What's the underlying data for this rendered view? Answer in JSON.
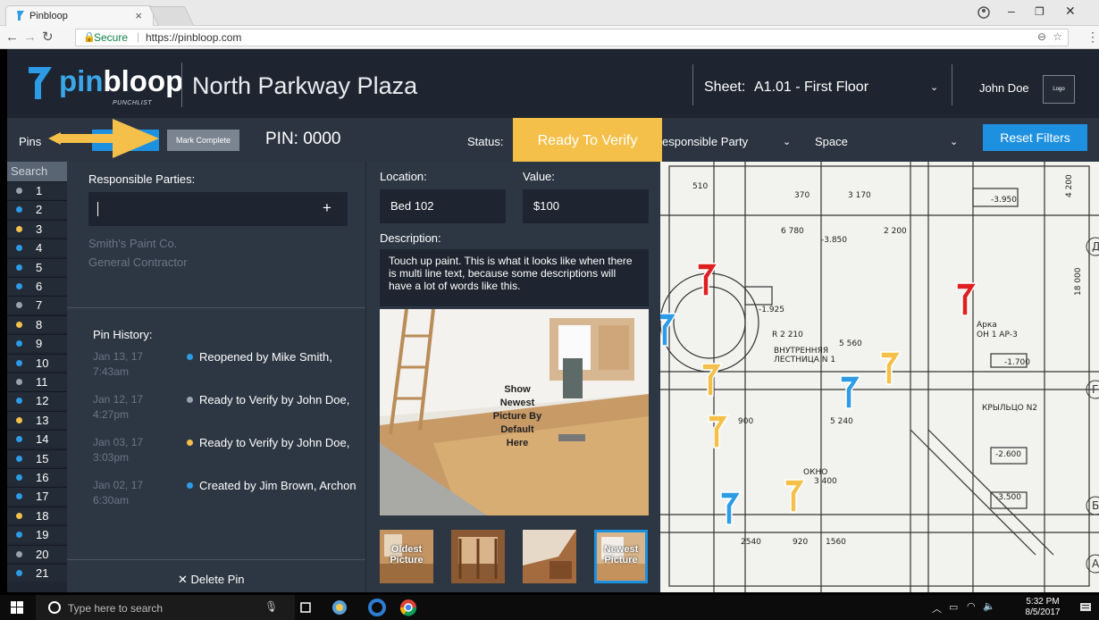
{
  "browser": {
    "tab_title": "Pinbloop",
    "tab_close": "×",
    "secure_label": "Secure",
    "url": "https://pinbloop.com"
  },
  "header": {
    "logo_part1": "pin",
    "logo_part2": "bloop",
    "logo_sub": "PUNCHLIST",
    "project_title": "North Parkway Plaza",
    "sheet_label": "Sheet:",
    "sheet_value": "A1.01 - First Floor",
    "user_name": "John Doe",
    "logo_box": "Logo"
  },
  "toolbar": {
    "pins_label": "Pins",
    "mark_complete": "Mark Complete",
    "pin_label": "PIN:  0000",
    "status_label": "Status:",
    "status_value": "Ready To Verify",
    "responsible_party_filter": "esponsible Party",
    "space_filter": "Space",
    "reset_filters": "Reset Filters"
  },
  "pin_list": {
    "search_label": "Search",
    "pins": [
      {
        "num": "1",
        "color": "#9aa3ad"
      },
      {
        "num": "2",
        "color": "#2d9be6"
      },
      {
        "num": "3",
        "color": "#f4c04a"
      },
      {
        "num": "4",
        "color": "#2d9be6"
      },
      {
        "num": "5",
        "color": "#2d9be6"
      },
      {
        "num": "6",
        "color": "#2d9be6"
      },
      {
        "num": "7",
        "color": "#9aa3ad"
      },
      {
        "num": "8",
        "color": "#f4c04a"
      },
      {
        "num": "9",
        "color": "#2d9be6"
      },
      {
        "num": "10",
        "color": "#2d9be6"
      },
      {
        "num": "11",
        "color": "#9aa3ad"
      },
      {
        "num": "12",
        "color": "#2d9be6"
      },
      {
        "num": "13",
        "color": "#f4c04a"
      },
      {
        "num": "14",
        "color": "#2d9be6"
      },
      {
        "num": "15",
        "color": "#2d9be6"
      },
      {
        "num": "16",
        "color": "#2d9be6"
      },
      {
        "num": "17",
        "color": "#2d9be6"
      },
      {
        "num": "18",
        "color": "#f4c04a"
      },
      {
        "num": "19",
        "color": "#2d9be6"
      },
      {
        "num": "20",
        "color": "#9aa3ad"
      },
      {
        "num": "21",
        "color": "#2d9be6"
      }
    ]
  },
  "detail": {
    "responsible_parties_title": "Responsible Parties:",
    "add_symbol": "+",
    "responsible_parties": [
      "Smith's Paint Co.",
      "General Contractor"
    ],
    "pin_history_title": "Pin History:",
    "history": [
      {
        "date": "Jan 13, 17",
        "time": "7:43am",
        "text": "Reopened by Mike Smith,",
        "color": "#2d9be6"
      },
      {
        "date": "Jan 12, 17",
        "time": "4:27pm",
        "text": "Ready to Verify by John Doe,",
        "color": "#9aa3ad"
      },
      {
        "date": "Jan 03, 17",
        "time": "3:03pm",
        "text": "Ready to Verify by John Doe,",
        "color": "#f4c04a"
      },
      {
        "date": "Jan 02, 17",
        "time": "6:30am",
        "text": "Created by Jim Brown, Archon",
        "color": "#2d9be6"
      }
    ],
    "delete_pin": "✕  Delete Pin",
    "location_label": "Location:",
    "location_value": "Bed 102",
    "value_label": "Value:",
    "value_value": "$100",
    "description_label": "Description:",
    "description_text": "Touch up paint.  This is what it looks like when there is multi line text, because some descriptions will have a lot of words like this.",
    "photo_caption": "Show Newest Picture By Default Here",
    "thumb_oldest": "Oldest Picture",
    "thumb_newest": "Newest Picture"
  },
  "taskbar": {
    "search_placeholder": "Type here to search",
    "time": "5:32 PM",
    "date": "8/5/2017"
  }
}
